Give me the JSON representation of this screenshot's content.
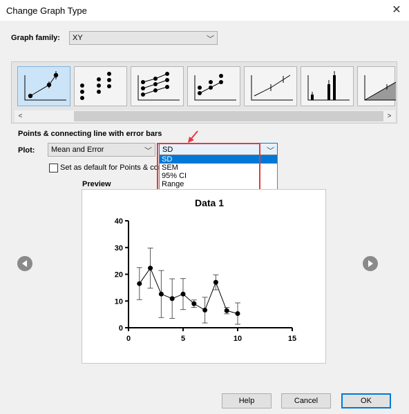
{
  "window": {
    "title": "Change Graph Type",
    "close_glyph": "✕"
  },
  "graph_family": {
    "label": "Graph family:",
    "value": "XY"
  },
  "gallery": {
    "thumbnails": [
      {
        "name": "points-connecting-error-bars",
        "selected": true
      },
      {
        "name": "points-only",
        "selected": false
      },
      {
        "name": "multiple-points-connected",
        "selected": false
      },
      {
        "name": "points-line",
        "selected": false
      },
      {
        "name": "line-error-bars",
        "selected": false
      },
      {
        "name": "spikes",
        "selected": false
      },
      {
        "name": "area-fill",
        "selected": false
      }
    ],
    "scroll_left": "<",
    "scroll_right": ">"
  },
  "section_title": "Points & connecting line with error bars",
  "plot": {
    "label": "Plot:",
    "mode_value": "Mean and Error",
    "error_value": "SD",
    "error_options": [
      "SD",
      "SEM",
      "95% CI",
      "Range"
    ],
    "highlighted_index": 0
  },
  "default_checkbox": {
    "label": "Set as default for Points & conn",
    "checked": false
  },
  "preview": {
    "label": "Preview"
  },
  "buttons": {
    "help": "Help",
    "cancel": "Cancel",
    "ok": "OK"
  },
  "colors": {
    "highlight": "#0078d7",
    "annotation": "#e8383d",
    "selected_thumb": "#cce4f7"
  },
  "chart_data": {
    "type": "scatter",
    "title": "Data 1",
    "xlabel": "",
    "ylabel": "",
    "xlim": [
      0,
      15
    ],
    "ylim": [
      0,
      40
    ],
    "x_ticks": [
      0,
      5,
      10,
      15
    ],
    "y_ticks": [
      0,
      10,
      20,
      30,
      40
    ],
    "connect_points": true,
    "grid": false,
    "points": [
      {
        "x": 1,
        "y": 16.5,
        "err": 6
      },
      {
        "x": 2,
        "y": 22.3,
        "err": 7.5
      },
      {
        "x": 3,
        "y": 12.6,
        "err": 8.8
      },
      {
        "x": 4,
        "y": 10.9,
        "err": 7.4
      },
      {
        "x": 5,
        "y": 12.6,
        "err": 5.8
      },
      {
        "x": 6,
        "y": 9.0,
        "err": 1.4
      },
      {
        "x": 7,
        "y": 6.6,
        "err": 4.8
      },
      {
        "x": 8,
        "y": 17.0,
        "err": 2.8
      },
      {
        "x": 9,
        "y": 6.4,
        "err": 1.2
      },
      {
        "x": 10,
        "y": 5.3,
        "err": 4.0
      }
    ]
  }
}
